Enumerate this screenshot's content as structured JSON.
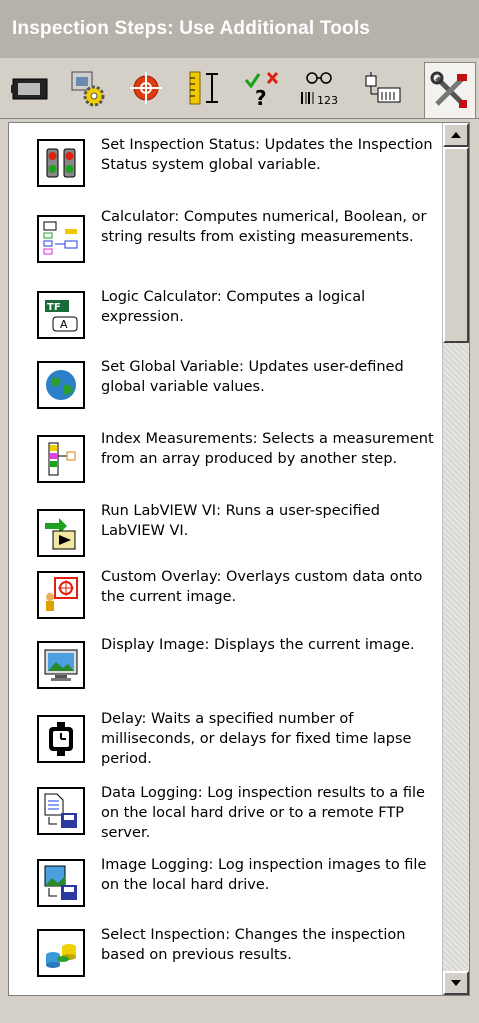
{
  "window": {
    "title": "Inspection Steps: Use Additional Tools"
  },
  "toolbar": {
    "tools": [
      {
        "icon": "acquire-image-icon"
      },
      {
        "icon": "enhance-image-icon"
      },
      {
        "icon": "locate-features-icon"
      },
      {
        "icon": "measure-features-icon"
      },
      {
        "icon": "check-for-presence-icon"
      },
      {
        "icon": "identify-parts-icon"
      },
      {
        "icon": "communicate-icon"
      },
      {
        "icon": "use-additional-tools-icon"
      }
    ],
    "active_index": 7
  },
  "steps": [
    {
      "icon": "traffic-light-icon",
      "text": "Set Inspection Status:  Updates the Inspection Status system global variable."
    },
    {
      "icon": "calculator-icon",
      "text": "Calculator:  Computes numerical, Boolean, or string results from existing measurements."
    },
    {
      "icon": "logic-calculator-icon",
      "text": "Logic Calculator:  Computes a logical expression."
    },
    {
      "icon": "globe-icon",
      "text": "Set Global Variable:  Updates user-defined global variable values."
    },
    {
      "icon": "index-measurements-icon",
      "text": "Index Measurements:  Selects a measurement from an array produced by another step."
    },
    {
      "icon": "run-vi-icon",
      "text": "Run LabVIEW VI:  Runs a user-specified LabVIEW VI."
    },
    {
      "icon": "custom-overlay-icon",
      "text": "Custom Overlay:  Overlays custom data onto the current image."
    },
    {
      "icon": "monitor-icon",
      "text": "Display Image:  Displays the current image."
    },
    {
      "icon": "stopwatch-icon",
      "text": "Delay:  Waits a specified number of milliseconds, or delays for fixed time lapse period."
    },
    {
      "icon": "data-logging-icon",
      "text": "Data Logging:  Log inspection results to a file on the local hard drive or to a remote FTP server."
    },
    {
      "icon": "image-logging-icon",
      "text": "Image Logging:  Log inspection images to file on the local hard drive."
    },
    {
      "icon": "select-inspection-icon",
      "text": "Select Inspection:  Changes the inspection based on previous results."
    }
  ],
  "toolbar_text": {
    "identify_digits": "123"
  },
  "logic_icon_text": {
    "tf": "TF",
    "a": "A"
  },
  "scroll": {
    "position_fraction": 0.0
  }
}
